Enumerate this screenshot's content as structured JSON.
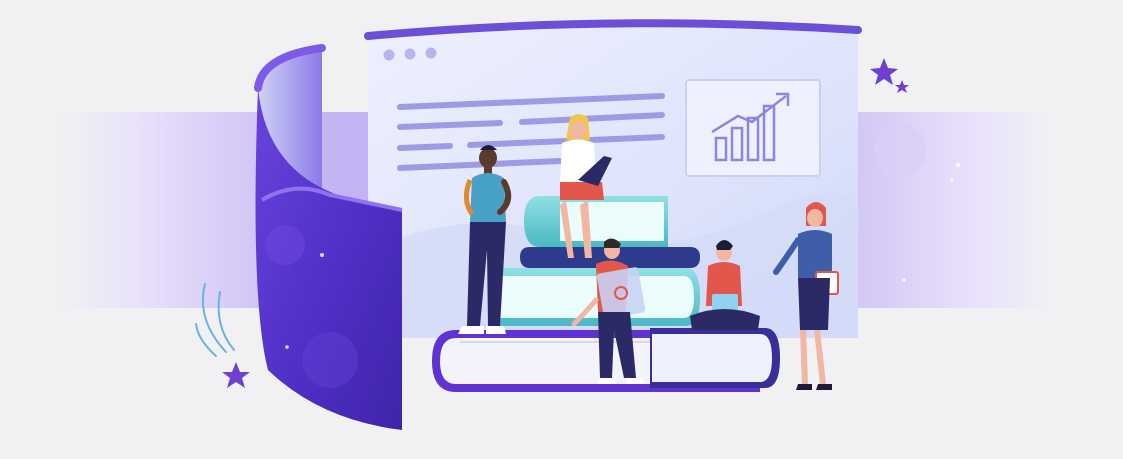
{
  "illustration": {
    "colors": {
      "background": "#f1f1f3",
      "band": "#c9b8f2",
      "window_bg": "#dfe4fb",
      "window_bar": "#6b4fd6",
      "panel_front": "#5b36d1",
      "panel_edge": "#7d5be8",
      "book_dark": "#2e3a8c",
      "book_teal": "#5fc7cf",
      "book_purple": "#6a3fd6",
      "star": "#6e3fd0",
      "skin_dark": "#5a3a2a",
      "skin_light": "#f2b7a3",
      "shirt_red": "#e2574c",
      "shirt_teal": "#47a0c6"
    },
    "icons": {
      "window_dots": "traffic-light-dots",
      "chart_card": "rising-bar-chart",
      "stars": "sparkle-stars"
    }
  }
}
